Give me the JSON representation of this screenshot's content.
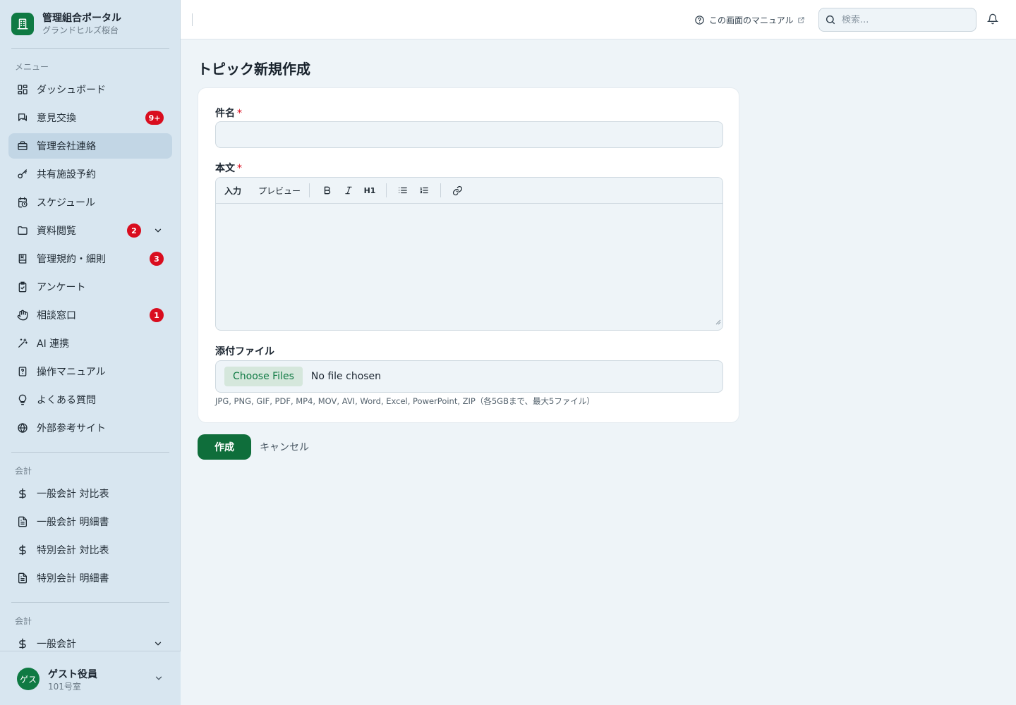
{
  "app": {
    "brand_title": "管理組合ポータル",
    "brand_subtitle": "グランドヒルズ桜台"
  },
  "sidebar": {
    "menu_label": "メニュー",
    "items": [
      {
        "label": "ダッシュボード",
        "icon": "dashboard-icon"
      },
      {
        "label": "意見交換",
        "icon": "chat-icon",
        "badge": "9+"
      },
      {
        "label": "管理会社連絡",
        "icon": "briefcase-icon",
        "active": true
      },
      {
        "label": "共有施設予約",
        "icon": "key-icon"
      },
      {
        "label": "スケジュール",
        "icon": "calendar-clock-icon"
      },
      {
        "label": "資料閲覧",
        "icon": "folder-icon",
        "badge": "2",
        "expandable": true
      },
      {
        "label": "管理規約・細則",
        "icon": "book-icon",
        "badge": "3"
      },
      {
        "label": "アンケート",
        "icon": "clipboard-check-icon"
      },
      {
        "label": "相談窓口",
        "icon": "hand-icon",
        "badge": "1"
      },
      {
        "label": "AI 連携",
        "icon": "magic-wand-icon"
      },
      {
        "label": "操作マニュアル",
        "icon": "manual-icon"
      },
      {
        "label": "よくある質問",
        "icon": "lightbulb-icon"
      },
      {
        "label": "外部参考サイト",
        "icon": "globe-icon"
      }
    ],
    "accounting_label": "会計",
    "accounting_items": [
      {
        "label": "一般会計 対比表",
        "icon": "dollar-icon"
      },
      {
        "label": "一般会計 明細書",
        "icon": "document-icon"
      },
      {
        "label": "特別会計 対比表",
        "icon": "dollar-icon"
      },
      {
        "label": "特別会計 明細書",
        "icon": "document-icon"
      }
    ],
    "accounting2_label": "会計",
    "accounting2_items": [
      {
        "label": "一般会計",
        "icon": "dollar-icon",
        "expandable": true
      }
    ]
  },
  "user": {
    "avatar_text": "ゲス",
    "name": "ゲスト役員",
    "room": "101号室"
  },
  "topbar": {
    "manual_link": "この画面のマニュアル",
    "search_placeholder": "検索..."
  },
  "page": {
    "title": "トピック新規作成"
  },
  "form": {
    "subject_label": "件名",
    "subject_value": "",
    "body_label": "本文",
    "required_mark": "*",
    "editor_tabs": [
      "入力",
      "プレビュー"
    ],
    "editor_tools": [
      "bold-icon",
      "italic-icon",
      "heading1-icon",
      "bullet-list-icon",
      "numbered-list-icon",
      "link-icon"
    ],
    "heading_button_text": "H1",
    "attachment_label": "添付ファイル",
    "choose_files": "Choose Files",
    "no_file": "No file chosen",
    "file_hint": "JPG, PNG, GIF, PDF, MP4, MOV, AVI, Word, Excel, PowerPoint, ZIP（各5GBまで、最大5ファイル）"
  },
  "actions": {
    "create": "作成",
    "cancel": "キャンセル"
  },
  "colors": {
    "brand_green": "#0f7a43",
    "sidebar_bg": "#d8e6f0",
    "active_item_bg": "#c2d6e5",
    "badge_red": "#d90d1e",
    "page_bg": "#eef4f8"
  }
}
